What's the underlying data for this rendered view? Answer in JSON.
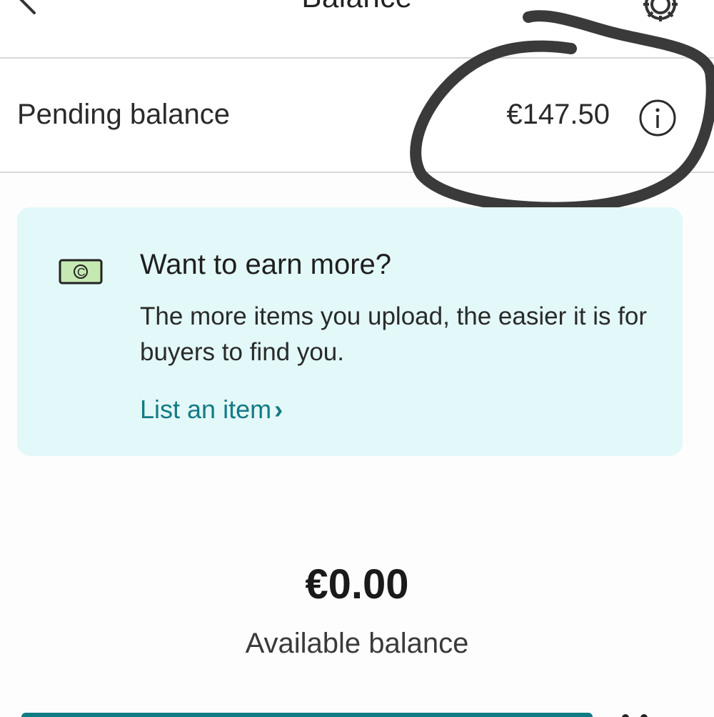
{
  "header": {
    "title": "Balance",
    "back_icon": "arrow-left-icon",
    "settings_icon": "gear-icon"
  },
  "pending": {
    "label": "Pending balance",
    "amount": "€147.50",
    "info_icon": "info-icon"
  },
  "promo": {
    "icon": "money-icon",
    "title": "Want to earn more?",
    "body": "The more items you upload, the easier it is for buyers to find you.",
    "link_label": "List an item",
    "link_chevron": "›"
  },
  "available": {
    "amount": "€0.00",
    "label": "Available balance"
  },
  "colors": {
    "accent": "#137a85",
    "promo_bg": "#e3f8f8",
    "scribble": "#3a3a3a"
  }
}
